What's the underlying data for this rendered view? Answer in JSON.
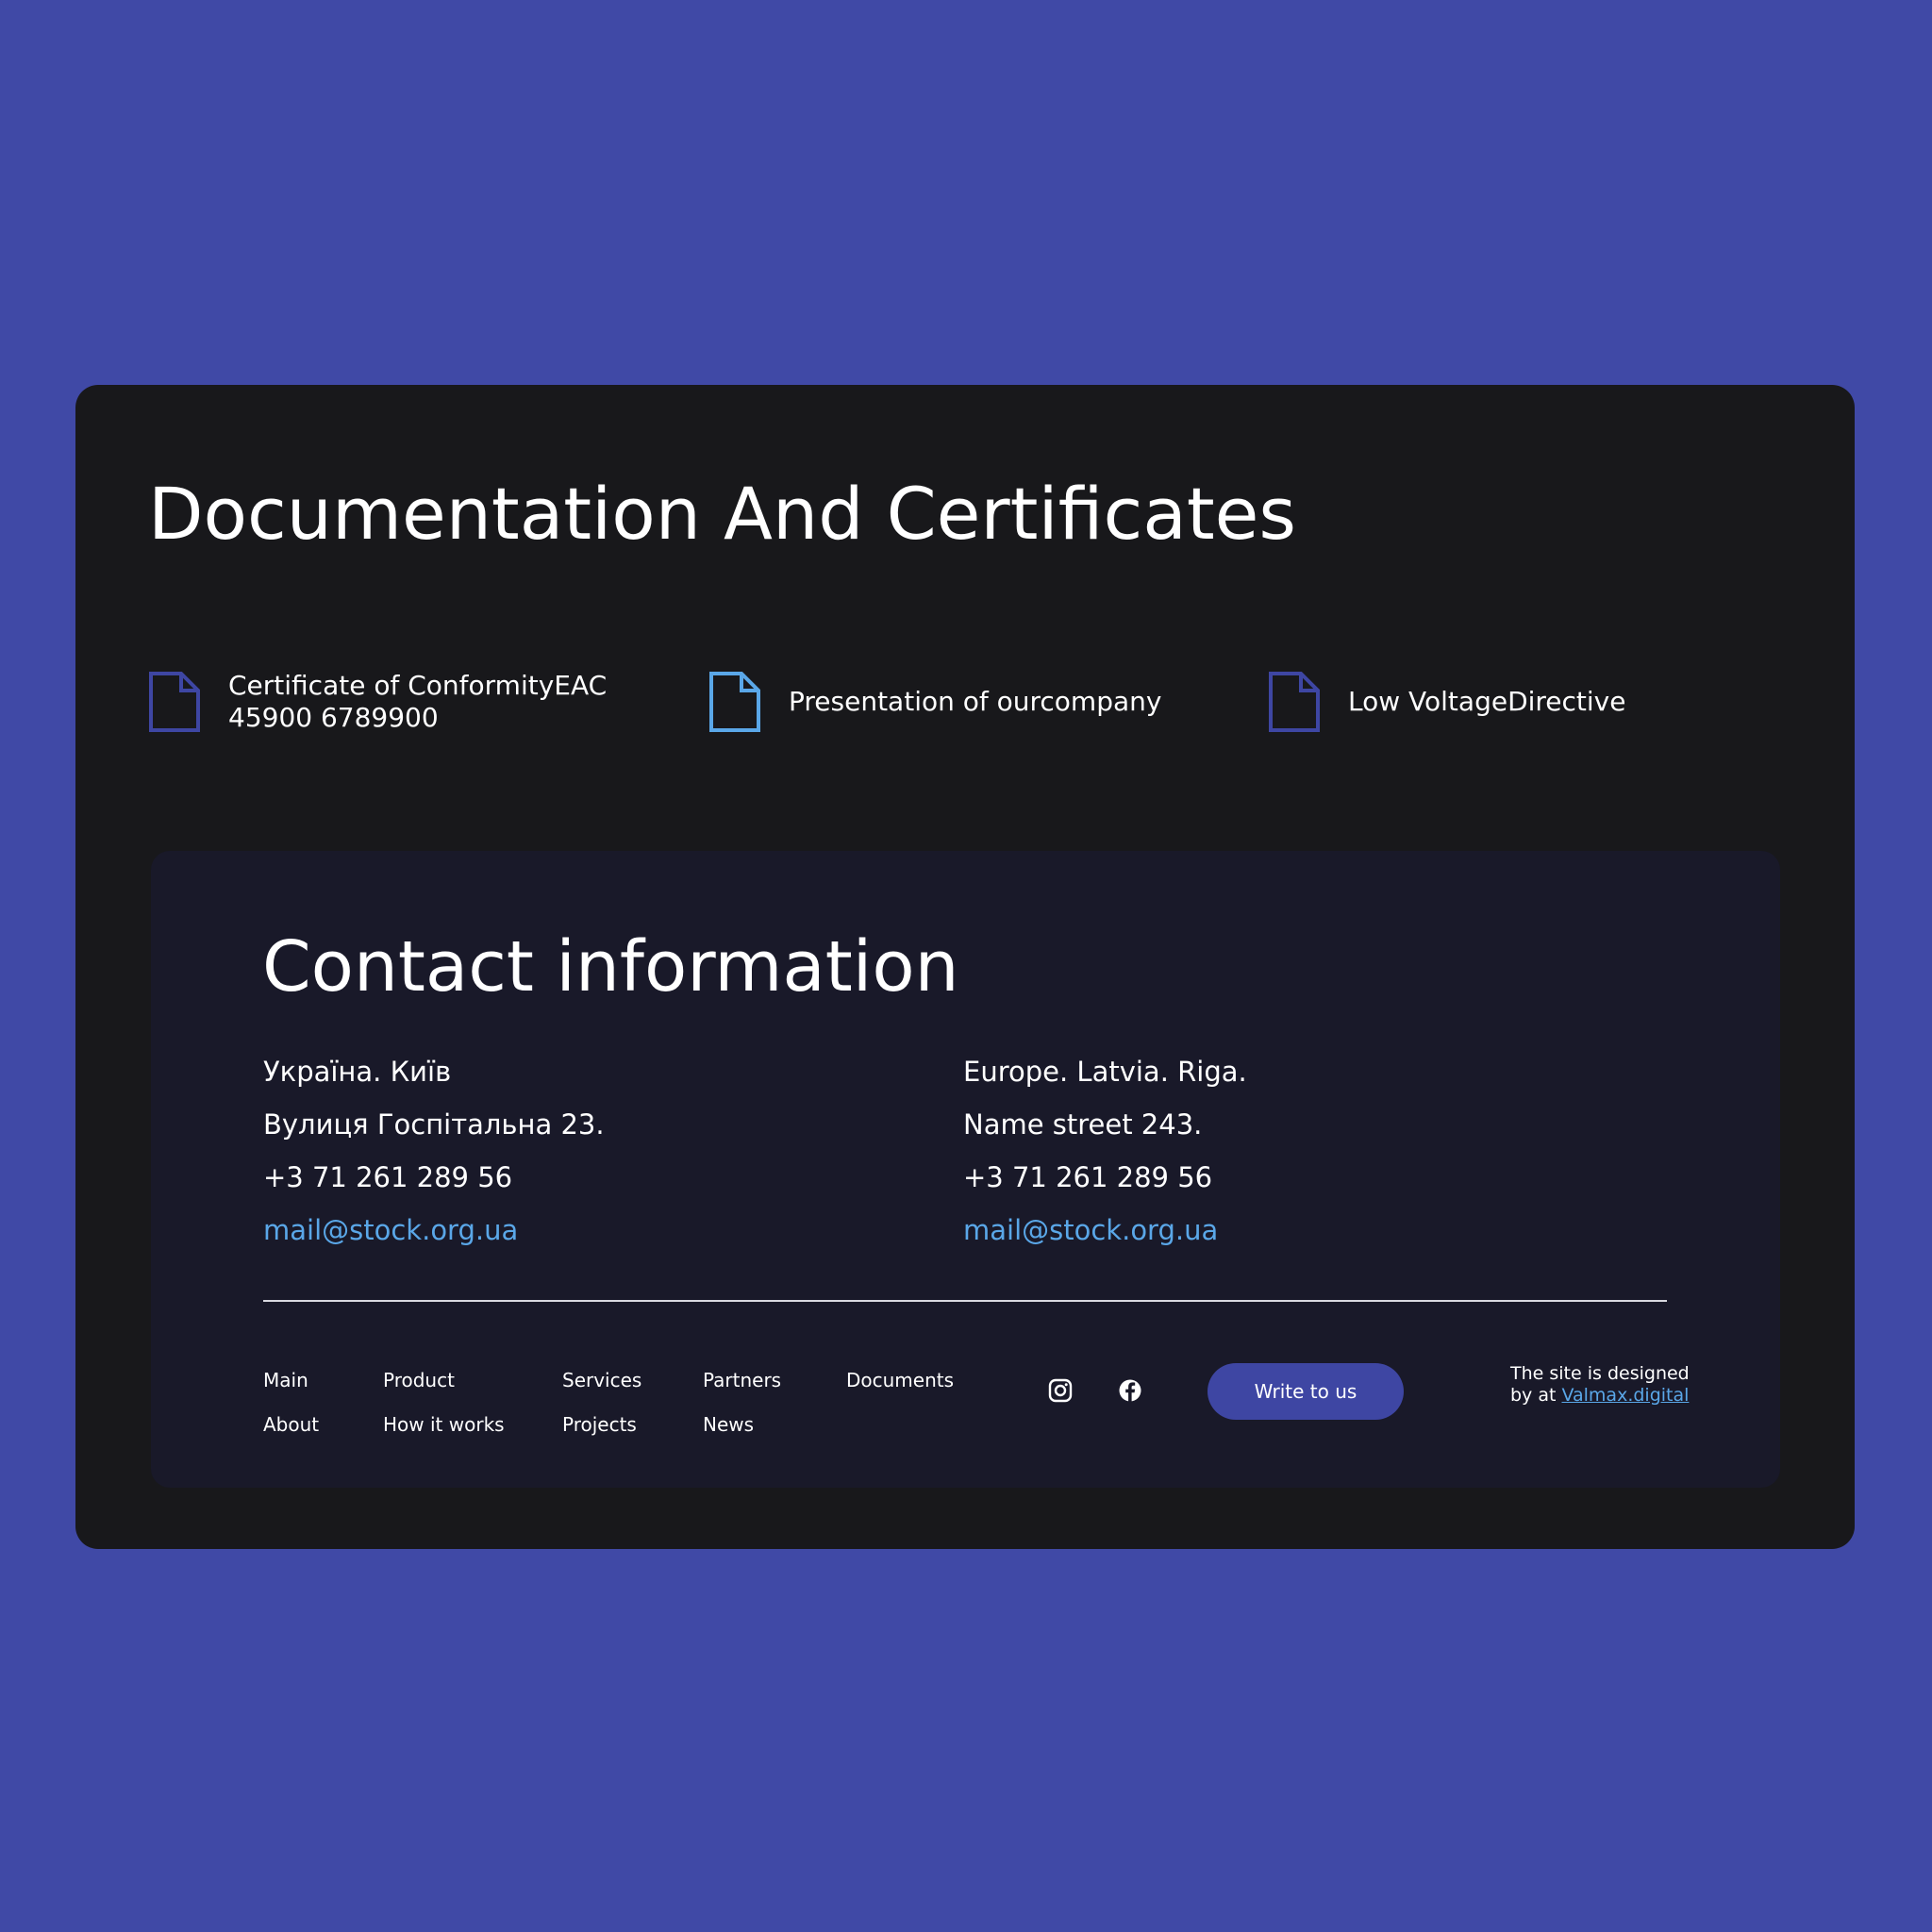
{
  "docs": {
    "title": "Documentation And Certificates",
    "items": [
      {
        "label": "Certificate of ConformityEAC\n45900 6789900",
        "icon": "document-icon",
        "icon_color": "#3E46A3"
      },
      {
        "label": "Presentation of ourcompany",
        "icon": "document-icon",
        "icon_color": "#5AA7E8"
      },
      {
        "label": "Low VoltageDirective",
        "icon": "document-icon",
        "icon_color": "#3E46A3"
      }
    ]
  },
  "contact": {
    "title": "Contact information",
    "left": {
      "location": "Україна. Київ",
      "street": "Вулиця Госпітальна 23.",
      "phone": "+3 71 261 289 56",
      "email": "mail@stock.org.ua"
    },
    "right": {
      "location": "Europe. Latvia. Riga.",
      "street": "Name street 243.",
      "phone": "+3 71 261 289 56",
      "email": "mail@stock.org.ua"
    }
  },
  "footer": {
    "nav": {
      "main": "Main",
      "about": "About",
      "product": "Product",
      "how_it_works": "How it works",
      "services": "Services",
      "projects": "Projects",
      "partners": "Partners",
      "news": "News",
      "documents": "Documents"
    },
    "social": {
      "instagram": "instagram-icon",
      "facebook": "facebook-icon"
    },
    "write_button": "Write to us",
    "credit": {
      "line1": "The site is designed",
      "line2": "by at ",
      "link": "Valmax.digital"
    }
  },
  "colors": {
    "background": "#4049A6",
    "card": "#18181B",
    "panel": "#191929",
    "accent": "#3E46A3",
    "link": "#5AA7E8",
    "text": "#FFFFFF"
  }
}
